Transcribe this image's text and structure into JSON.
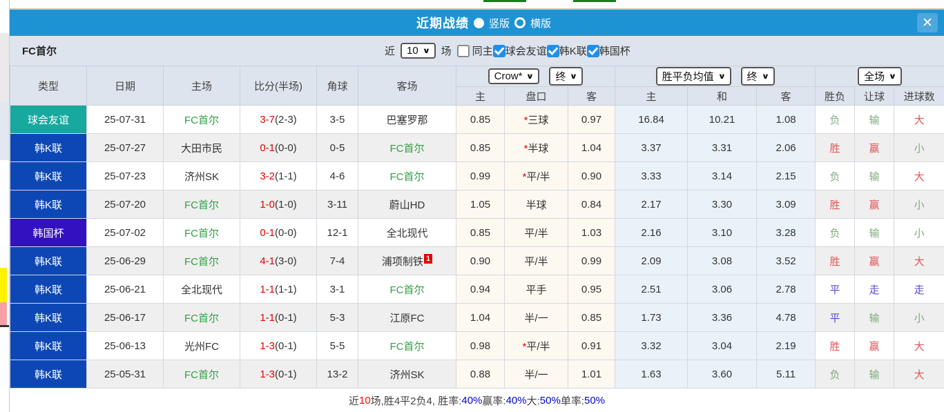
{
  "titlebar": {
    "title": "近期战绩",
    "options": [
      {
        "label": "竖版",
        "selected": true
      },
      {
        "label": "横版",
        "selected": false
      }
    ],
    "close": "✕",
    "bg": "#1e93d4"
  },
  "filterbar": {
    "team": "FC首尔",
    "recent_label": "近",
    "recent_value": "10",
    "field_label": "场",
    "same_home": {
      "label": "同主",
      "checked": false
    },
    "league_filters": [
      {
        "label": "球会友谊",
        "checked": true
      },
      {
        "label": "韩K联",
        "checked": true
      },
      {
        "label": "韩国杯",
        "checked": true
      }
    ]
  },
  "table": {
    "col_headers": [
      "类型",
      "日期",
      "主场",
      "比分(半场)",
      "角球",
      "客场"
    ],
    "odds_select": "Crow*",
    "odds_period_select": "终",
    "odds_sub_headers": [
      "主",
      "盘口",
      "客"
    ],
    "avg_select": "胜平负均值",
    "avg_period_select": "终",
    "avg_sub_headers": [
      "主",
      "和",
      "客"
    ],
    "scope_select": "全场",
    "result_headers": [
      "胜负",
      "让球",
      "进球数"
    ],
    "type_colors": {
      "球会友谊": "#17a89e",
      "韩K联": "#0d47b5",
      "韩国杯": "#3311c0"
    },
    "rows": [
      {
        "type": "球会友谊",
        "date": "25-07-31",
        "home": "FC首尔",
        "home_highlight": true,
        "score": "3-7",
        "half": "(2-3)",
        "corners": "3-5",
        "away": "巴塞罗那",
        "away_highlight": false,
        "away_badge": "",
        "odds_home": "0.85",
        "handicap_star": true,
        "handicap": "三球",
        "odds_away": "0.97",
        "avg_home": "16.84",
        "avg_draw": "10.21",
        "avg_away": "1.08",
        "outcome": "负",
        "outcome_color": "green",
        "handicap_outcome": "输",
        "handicap_outcome_color": "green",
        "goals_outcome": "大",
        "goals_outcome_color": "red"
      },
      {
        "type": "韩K联",
        "date": "25-07-27",
        "home": "大田市民",
        "home_highlight": false,
        "score": "0-1",
        "half": "(0-0)",
        "corners": "0-5",
        "away": "FC首尔",
        "away_highlight": true,
        "away_badge": "",
        "odds_home": "0.85",
        "handicap_star": true,
        "handicap": "半球",
        "odds_away": "1.04",
        "avg_home": "3.37",
        "avg_draw": "3.31",
        "avg_away": "2.06",
        "outcome": "胜",
        "outcome_color": "red",
        "handicap_outcome": "赢",
        "handicap_outcome_color": "red",
        "goals_outcome": "小",
        "goals_outcome_color": "green"
      },
      {
        "type": "韩K联",
        "date": "25-07-23",
        "home": "济州SK",
        "home_highlight": false,
        "score": "3-2",
        "half": "(1-1)",
        "corners": "4-6",
        "away": "FC首尔",
        "away_highlight": true,
        "away_badge": "",
        "odds_home": "0.99",
        "handicap_star": true,
        "handicap": "平/半",
        "odds_away": "0.90",
        "avg_home": "3.33",
        "avg_draw": "3.14",
        "avg_away": "2.15",
        "outcome": "负",
        "outcome_color": "green",
        "handicap_outcome": "输",
        "handicap_outcome_color": "green",
        "goals_outcome": "大",
        "goals_outcome_color": "red"
      },
      {
        "type": "韩K联",
        "date": "25-07-20",
        "home": "FC首尔",
        "home_highlight": true,
        "score": "1-0",
        "half": "(1-0)",
        "corners": "3-11",
        "away": "蔚山HD",
        "away_highlight": false,
        "away_badge": "",
        "odds_home": "1.05",
        "handicap_star": false,
        "handicap": "半球",
        "odds_away": "0.84",
        "avg_home": "2.17",
        "avg_draw": "3.30",
        "avg_away": "3.09",
        "outcome": "胜",
        "outcome_color": "red",
        "handicap_outcome": "赢",
        "handicap_outcome_color": "red",
        "goals_outcome": "小",
        "goals_outcome_color": "green"
      },
      {
        "type": "韩国杯",
        "date": "25-07-02",
        "home": "FC首尔",
        "home_highlight": true,
        "score": "0-1",
        "half": "(0-0)",
        "corners": "12-1",
        "away": "全北现代",
        "away_highlight": false,
        "away_badge": "",
        "odds_home": "0.85",
        "handicap_star": false,
        "handicap": "平/半",
        "odds_away": "1.03",
        "avg_home": "2.16",
        "avg_draw": "3.10",
        "avg_away": "3.28",
        "outcome": "负",
        "outcome_color": "green",
        "handicap_outcome": "输",
        "handicap_outcome_color": "green",
        "goals_outcome": "小",
        "goals_outcome_color": "green"
      },
      {
        "type": "韩K联",
        "date": "25-06-29",
        "home": "FC首尔",
        "home_highlight": true,
        "score": "4-1",
        "half": "(3-0)",
        "corners": "7-4",
        "away": "浦项制铁",
        "away_highlight": false,
        "away_badge": "1",
        "odds_home": "0.90",
        "handicap_star": false,
        "handicap": "平/半",
        "odds_away": "0.99",
        "avg_home": "2.09",
        "avg_draw": "3.08",
        "avg_away": "3.52",
        "outcome": "胜",
        "outcome_color": "red",
        "handicap_outcome": "赢",
        "handicap_outcome_color": "red",
        "goals_outcome": "大",
        "goals_outcome_color": "red"
      },
      {
        "type": "韩K联",
        "date": "25-06-21",
        "home": "全北现代",
        "home_highlight": false,
        "score": "1-1",
        "half": "(1-1)",
        "corners": "3-1",
        "away": "FC首尔",
        "away_highlight": true,
        "away_badge": "",
        "odds_home": "0.94",
        "handicap_star": false,
        "handicap": "平手",
        "odds_away": "0.95",
        "avg_home": "2.51",
        "avg_draw": "3.06",
        "avg_away": "2.78",
        "outcome": "平",
        "outcome_color": "blue",
        "handicap_outcome": "走",
        "handicap_outcome_color": "blue",
        "goals_outcome": "走",
        "goals_outcome_color": "blue"
      },
      {
        "type": "韩K联",
        "date": "25-06-17",
        "home": "FC首尔",
        "home_highlight": true,
        "score": "1-1",
        "half": "(0-1)",
        "corners": "5-3",
        "away": "江原FC",
        "away_highlight": false,
        "away_badge": "",
        "odds_home": "1.04",
        "handicap_star": false,
        "handicap": "半/一",
        "odds_away": "0.85",
        "avg_home": "1.73",
        "avg_draw": "3.36",
        "avg_away": "4.78",
        "outcome": "平",
        "outcome_color": "blue",
        "handicap_outcome": "输",
        "handicap_outcome_color": "green",
        "goals_outcome": "小",
        "goals_outcome_color": "green"
      },
      {
        "type": "韩K联",
        "date": "25-06-13",
        "home": "光州FC",
        "home_highlight": false,
        "score": "1-3",
        "half": "(0-1)",
        "corners": "5-5",
        "away": "FC首尔",
        "away_highlight": true,
        "away_badge": "",
        "odds_home": "0.98",
        "handicap_star": true,
        "handicap": "平/半",
        "odds_away": "0.91",
        "avg_home": "3.32",
        "avg_draw": "3.04",
        "avg_away": "2.19",
        "outcome": "胜",
        "outcome_color": "red",
        "handicap_outcome": "赢",
        "handicap_outcome_color": "red",
        "goals_outcome": "大",
        "goals_outcome_color": "red"
      },
      {
        "type": "韩K联",
        "date": "25-05-31",
        "home": "FC首尔",
        "home_highlight": true,
        "score": "1-3",
        "half": "(0-1)",
        "corners": "13-2",
        "away": "济州SK",
        "away_highlight": false,
        "away_badge": "",
        "odds_home": "0.88",
        "handicap_star": false,
        "handicap": "半/一",
        "odds_away": "1.01",
        "avg_home": "1.63",
        "avg_draw": "3.60",
        "avg_away": "5.11",
        "outcome": "负",
        "outcome_color": "green",
        "handicap_outcome": "输",
        "handicap_outcome_color": "green",
        "goals_outcome": "大",
        "goals_outcome_color": "red"
      }
    ]
  },
  "summary": {
    "parts": [
      {
        "text": "近",
        "color": "dark"
      },
      {
        "text": "10",
        "color": "red"
      },
      {
        "text": "场,胜4平2负4, 胜率:",
        "color": "dark"
      },
      {
        "text": "40%",
        "color": "blue"
      },
      {
        "text": " 赢率:",
        "color": "dark"
      },
      {
        "text": "40%",
        "color": "blue"
      },
      {
        "text": " 大:",
        "color": "dark"
      },
      {
        "text": "50%",
        "color": "blue"
      },
      {
        "text": " 单率:",
        "color": "dark"
      },
      {
        "text": "50%",
        "color": "blue"
      }
    ]
  }
}
